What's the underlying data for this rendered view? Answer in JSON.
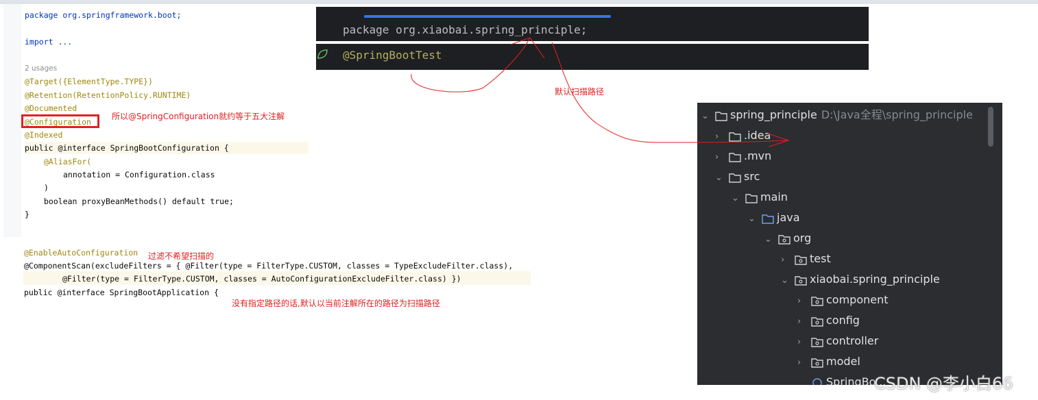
{
  "left_code": {
    "lines": [
      "package org.springframework.boot;",
      "import ...",
      "2 usages",
      "@Target({ElementType.TYPE})",
      "@Retention(RetentionPolicy.RUNTIME)",
      "@Documented",
      "@Configuration",
      "@Indexed",
      "public @interface SpringBootConfiguration {",
      "@AliasFor(",
      "annotation = Configuration.class",
      ")",
      "boolean proxyBeanMethods() default true;",
      "}"
    ]
  },
  "bottom_code": {
    "lines": [
      "@EnableAutoConfiguration",
      "@ComponentScan(excludeFilters = { @Filter(type = FilterType.CUSTOM, classes = TypeExcludeFilter.class),",
      "@Filter(type = FilterType.CUSTOM, classes = AutoConfigurationExcludeFilter.class) })",
      "public @interface SpringBootApplication {"
    ]
  },
  "annotations": {
    "configuration_note": "所以@SpringConfiguration就约等于五大注解",
    "filter_note": "过滤不希望扫描的",
    "default_path_note": "没有指定路径的话,默认以当前注解所在的路径为扫描路径",
    "scan_path_note": "默认扫描路径"
  },
  "dark_code": {
    "package_line": "package org.xiaobai.spring_principle;",
    "annotation_line": "@SpringBootTest"
  },
  "project_tree": {
    "root": "spring_principle",
    "root_path": "D:\\Java全程\\spring_principle",
    "items": [
      ".idea",
      ".mvn",
      "src",
      "main",
      "java",
      "org",
      "test",
      "xiaobai.spring_principle",
      "component",
      "config",
      "controller",
      "model",
      "SpringBo..."
    ]
  },
  "watermark": "CSDN @李小白66",
  "colors": {
    "accent_red": "#e02020",
    "tab_blue": "#3574f0",
    "tree_bg": "#2b2d30"
  }
}
